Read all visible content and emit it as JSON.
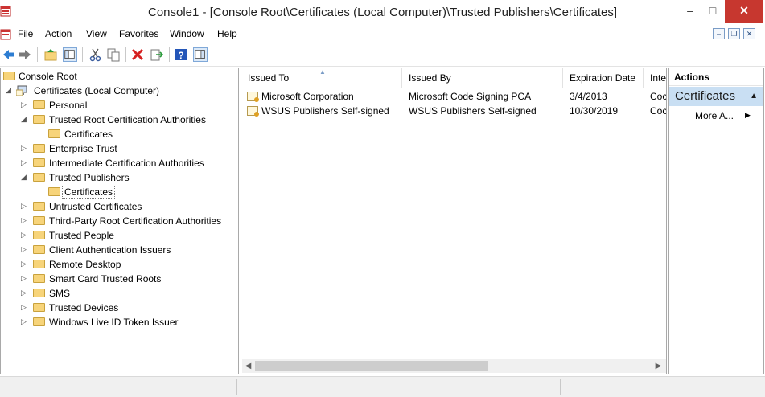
{
  "window": {
    "title": "Console1 - [Console Root\\Certificates (Local Computer)\\Trusted Publishers\\Certificates]"
  },
  "menu": [
    "File",
    "Action",
    "View",
    "Favorites",
    "Window",
    "Help"
  ],
  "tree": {
    "root": "Console Root",
    "computer": "Certificates (Local Computer)",
    "items": [
      {
        "label": "Personal"
      },
      {
        "label": "Trusted Root Certification Authorities"
      },
      {
        "label": "Certificates"
      },
      {
        "label": "Enterprise Trust"
      },
      {
        "label": "Intermediate Certification Authorities"
      },
      {
        "label": "Trusted Publishers"
      },
      {
        "label": "Certificates"
      },
      {
        "label": "Untrusted Certificates"
      },
      {
        "label": "Third-Party Root Certification Authorities"
      },
      {
        "label": "Trusted People"
      },
      {
        "label": "Client Authentication Issuers"
      },
      {
        "label": "Remote Desktop"
      },
      {
        "label": "Smart Card Trusted Roots"
      },
      {
        "label": "SMS"
      },
      {
        "label": "Trusted Devices"
      },
      {
        "label": "Windows Live ID Token Issuer"
      }
    ]
  },
  "list": {
    "columns": [
      "Issued To",
      "Issued By",
      "Expiration Date",
      "Inte"
    ],
    "rows": [
      [
        "Microsoft Corporation",
        "Microsoft Code Signing PCA",
        "3/4/2013",
        "Coc"
      ],
      [
        "WSUS Publishers Self-signed",
        "WSUS Publishers Self-signed",
        "10/30/2019",
        "Coc"
      ]
    ]
  },
  "actions": {
    "header": "Actions",
    "group": "Certificates",
    "more": "More A..."
  }
}
